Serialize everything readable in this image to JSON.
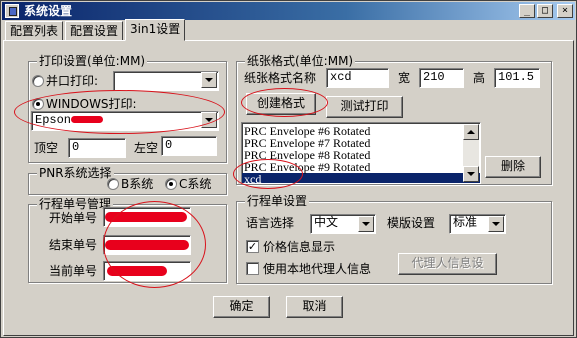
{
  "window": {
    "title": "系统设置"
  },
  "tabs": [
    "配置列表",
    "配置设置",
    "3in1设置"
  ],
  "print_settings": {
    "legend": "打印设置(单位:MM)",
    "parallel_label": "并口打印:",
    "parallel_value": "",
    "windows_label": "WINDOWS打印:",
    "windows_value": "Epson",
    "top_label": "顶空",
    "top_value": "0",
    "left_label": "左空",
    "left_value": "0"
  },
  "paper_format": {
    "legend": "纸张格式(单位:MM)",
    "name_label": "纸张格式名称",
    "name_value": "xcd",
    "width_label": "宽",
    "width_value": "210",
    "height_label": "高",
    "height_value": "101.5",
    "create_button": "创建格式",
    "test_button": "测试打印",
    "delete_button": "删除",
    "list": [
      "PRC Envelope #6 Rotated",
      "PRC Envelope #7 Rotated",
      "PRC Envelope #8 Rotated",
      "PRC Envelope #9 Rotated",
      "xcd"
    ]
  },
  "pnr": {
    "legend": "PNR系统选择",
    "option_b": "B系统",
    "option_c": "C系统"
  },
  "ticket_number": {
    "legend": "行程单号管理",
    "start_label": "开始单号",
    "end_label": "结束单号",
    "current_label": "当前单号"
  },
  "itinerary": {
    "legend": "行程单设置",
    "language_label": "语言选择",
    "language_value": "中文",
    "template_label": "模版设置",
    "template_value": "标准",
    "show_price_label": "价格信息显示",
    "use_agent_label": "使用本地代理人信息",
    "agent_button": "代理人信息设"
  },
  "footer": {
    "ok": "确定",
    "cancel": "取消"
  },
  "colors": {
    "annotation_red": "#d8121b",
    "title_bar": "#0a246a",
    "selection": "#0a246a"
  }
}
